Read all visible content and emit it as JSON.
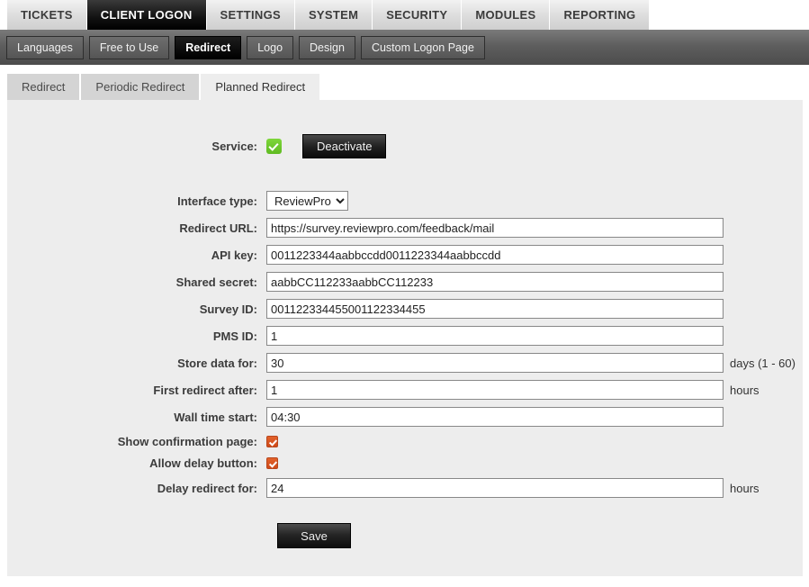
{
  "primary_nav": {
    "items": [
      {
        "label": "TICKETS",
        "active": false
      },
      {
        "label": "CLIENT LOGON",
        "active": true
      },
      {
        "label": "SETTINGS",
        "active": false
      },
      {
        "label": "SYSTEM",
        "active": false
      },
      {
        "label": "SECURITY",
        "active": false
      },
      {
        "label": "MODULES",
        "active": false
      },
      {
        "label": "REPORTING",
        "active": false
      }
    ]
  },
  "secondary_nav": {
    "items": [
      {
        "label": "Languages",
        "active": false
      },
      {
        "label": "Free to Use",
        "active": false
      },
      {
        "label": "Redirect",
        "active": true
      },
      {
        "label": "Logo",
        "active": false
      },
      {
        "label": "Design",
        "active": false
      },
      {
        "label": "Custom Logon Page",
        "active": false
      }
    ]
  },
  "tertiary_nav": {
    "items": [
      {
        "label": "Redirect",
        "active": false
      },
      {
        "label": "Periodic Redirect",
        "active": false
      },
      {
        "label": "Planned Redirect",
        "active": true
      }
    ]
  },
  "form": {
    "service": {
      "label": "Service:",
      "checked": true,
      "toggle_button": "Deactivate"
    },
    "interface_type": {
      "label": "Interface type:",
      "selected": "ReviewPro",
      "options": [
        "ReviewPro"
      ]
    },
    "redirect_url": {
      "label": "Redirect URL:",
      "value": "https://survey.reviewpro.com/feedback/mail",
      "placeholder": ""
    },
    "api_key": {
      "label": "API key:",
      "value": "0011223344aabbccdd0011223344aabbccdd",
      "placeholder": ""
    },
    "shared_secret": {
      "label": "Shared secret:",
      "value": "aabbCC112233aabbCC112233",
      "placeholder": ""
    },
    "survey_id": {
      "label": "Survey ID:",
      "value": "001122334455001122334455",
      "placeholder": ""
    },
    "pms_id": {
      "label": "PMS ID:",
      "value": "1",
      "placeholder": ""
    },
    "store_data_for": {
      "label": "Store data for:",
      "value": "30",
      "suffix": "days (1 - 60)",
      "placeholder": ""
    },
    "first_redirect_after": {
      "label": "First redirect after:",
      "value": "1",
      "suffix": "hours",
      "placeholder": ""
    },
    "wall_time_start": {
      "label": "Wall time start:",
      "value": "04:30",
      "placeholder": ""
    },
    "show_confirmation_page": {
      "label": "Show confirmation page:",
      "checked": true
    },
    "allow_delay_button": {
      "label": "Allow delay button:",
      "checked": true
    },
    "delay_redirect_for": {
      "label": "Delay redirect for:",
      "value": "24",
      "suffix": "hours",
      "placeholder": ""
    },
    "save_button": "Save"
  },
  "colors": {
    "panel_bg": "#ededed",
    "accent_green": "#6ec62e",
    "accent_orange": "#d44f1c",
    "nav_dark": "#000000",
    "secondary_bar": "#5e5e5e"
  }
}
